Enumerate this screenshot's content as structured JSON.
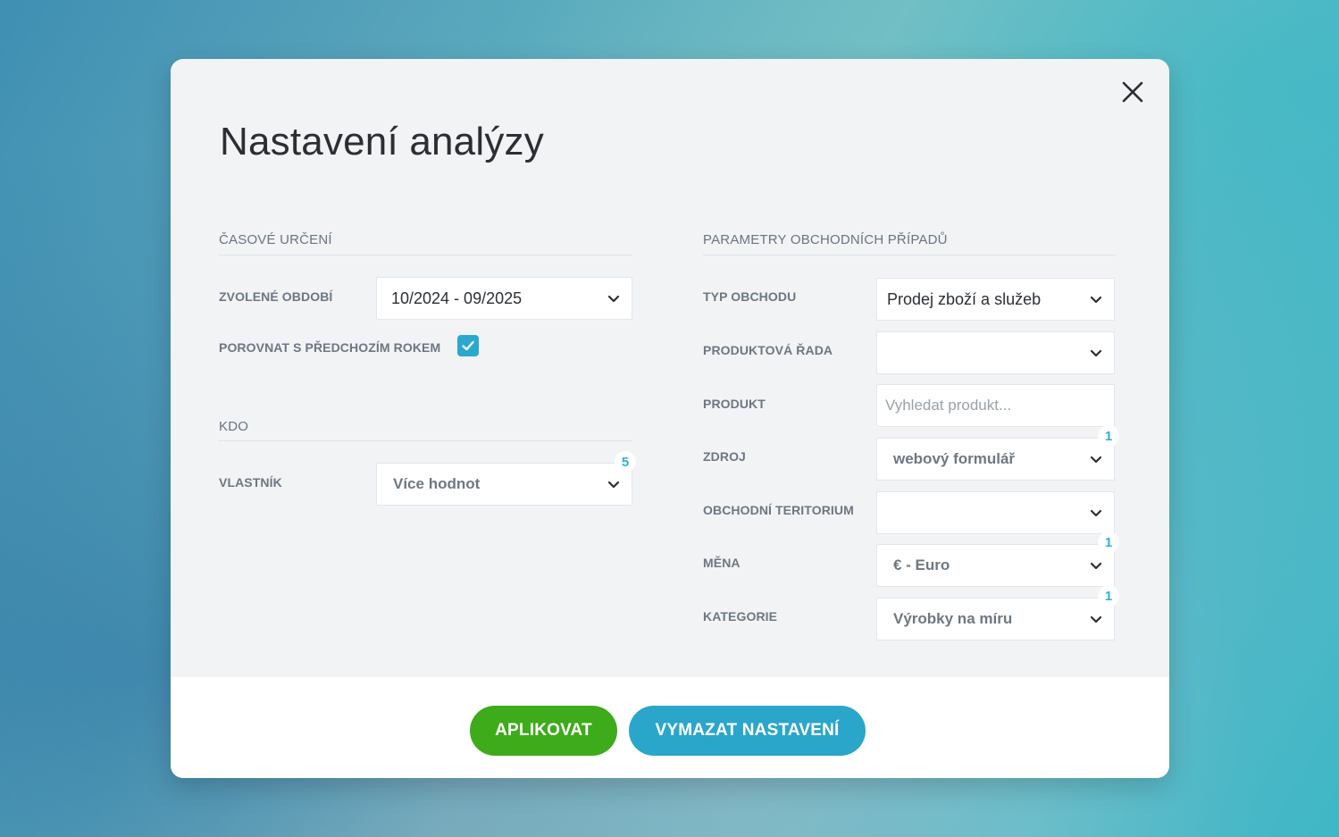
{
  "dialog": {
    "title": "Nastavení analýzy"
  },
  "time_section": {
    "heading": "ČASOVÉ URČENÍ",
    "period_label": "ZVOLENÉ OBDOBÍ",
    "period_value": "10/2024 - 09/2025",
    "compare_label": "POROVNAT S PŘEDCHOZÍM ROKEM",
    "compare_checked": true
  },
  "who_section": {
    "heading": "KDO",
    "owner_label": "VLASTNÍK",
    "owner_value": "Více hodnot",
    "owner_count": "5"
  },
  "deal_section": {
    "heading": "PARAMETRY OBCHODNÍCH PŘÍPADŮ",
    "deal_type_label": "TYP OBCHODU",
    "deal_type_value": "Prodej zboží a služeb",
    "product_line_label": "PRODUKTOVÁ ŘADA",
    "product_line_value": "",
    "product_label": "PRODUKT",
    "product_placeholder": "Vyhledat produkt...",
    "source_label": "ZDROJ",
    "source_value": "webový formulář",
    "source_count": "1",
    "territory_label": "OBCHODNÍ TERITORIUM",
    "territory_value": "",
    "currency_label": "MĚNA",
    "currency_value": "€ - Euro",
    "currency_count": "1",
    "category_label": "KATEGORIE",
    "category_value": "Výrobky na míru",
    "category_count": "1"
  },
  "footer": {
    "apply_label": "APLIKOVAT",
    "clear_label": "VYMAZAT NASTAVENÍ"
  },
  "colors": {
    "apply_button": "#3eab1b",
    "clear_button": "#2ba6cb",
    "checkbox": "#2aa9d0",
    "badge_text": "#2fb2cf"
  },
  "icons": {
    "close": "close-icon",
    "dropdown": "chevron-down-icon",
    "check": "check-icon"
  }
}
